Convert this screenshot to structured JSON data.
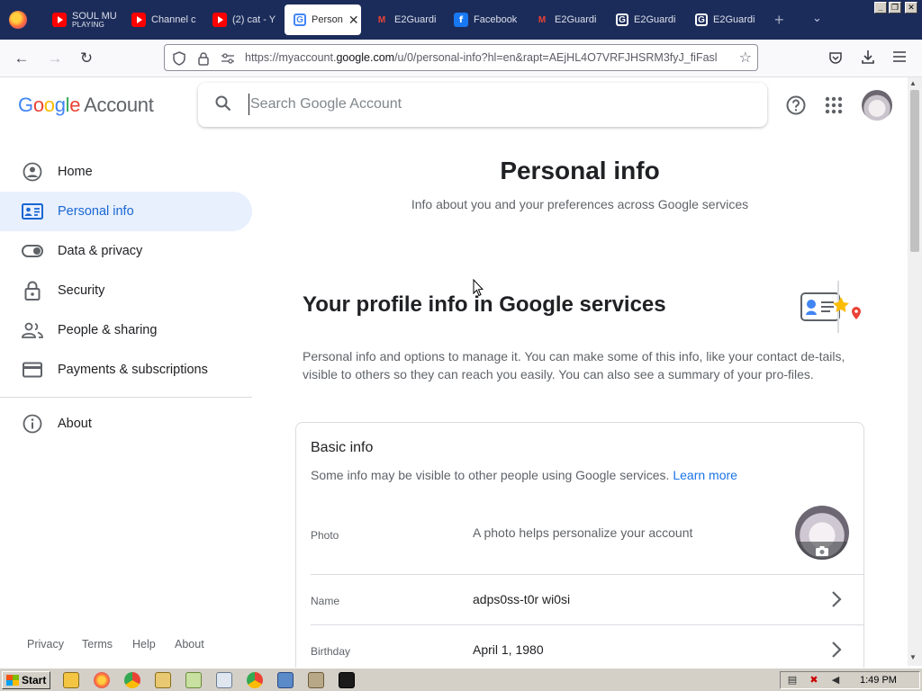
{
  "browser": {
    "tabs": [
      {
        "label": "SOUL MU",
        "sublabel": "PLAYING",
        "icon": "youtube-icon"
      },
      {
        "label": "Channel c",
        "icon": "youtube-icon"
      },
      {
        "label": "(2) cat - Y",
        "icon": "youtube-icon"
      },
      {
        "label": "Person",
        "icon": "google-icon",
        "active": true
      },
      {
        "label": "E2Guardi",
        "icon": "gmail-icon"
      },
      {
        "label": "Facebook",
        "icon": "facebook-icon"
      },
      {
        "label": "E2Guardi",
        "icon": "gmail-icon"
      },
      {
        "label": "E2Guardi",
        "icon": "google-icon"
      },
      {
        "label": "E2Guardi",
        "icon": "google-icon"
      }
    ],
    "url": {
      "prefix": "https://myaccount.",
      "domain": "google.com",
      "path": "/u/0/personal-info?hl=en&rapt=AEjHL4O7VRFJHSRM3fyJ_fiFasl"
    }
  },
  "header": {
    "logo_word": [
      "G",
      "o",
      "o",
      "g",
      "l",
      "e"
    ],
    "logo_suffix": "Account",
    "search_placeholder": "Search Google Account"
  },
  "sidebar": {
    "items": [
      {
        "label": "Home",
        "icon": "account-circle-icon"
      },
      {
        "label": "Personal info",
        "icon": "id-card-icon",
        "active": true
      },
      {
        "label": "Data & privacy",
        "icon": "toggle-icon"
      },
      {
        "label": "Security",
        "icon": "lock-icon"
      },
      {
        "label": "People & sharing",
        "icon": "people-icon"
      },
      {
        "label": "Payments & subscriptions",
        "icon": "credit-card-icon"
      }
    ],
    "about": {
      "label": "About",
      "icon": "info-icon"
    },
    "footer": [
      "Privacy",
      "Terms",
      "Help",
      "About"
    ]
  },
  "main": {
    "title": "Personal info",
    "subtitle": "Info about you and your preferences across Google services",
    "section_title": "Your profile info in Google services",
    "section_desc": "Personal info and options to manage it. You can make some of this info, like your contact de-tails, visible to others so they can reach you easily. You can also see a summary of your pro-files.",
    "card": {
      "title": "Basic info",
      "desc": "Some info may be visible to other people using Google services.",
      "learn_more": "Learn more",
      "rows": [
        {
          "label": "Photo",
          "value": "A photo helps personalize your account"
        },
        {
          "label": "Name",
          "value": "adps0ss-t0r wi0si"
        },
        {
          "label": "Birthday",
          "value": "April 1, 1980"
        }
      ]
    }
  },
  "taskbar": {
    "start_label": "Start",
    "clock": "1:49 PM"
  },
  "colors": {
    "accent": "#1a73e8",
    "active_nav_bg": "#e8f0fe",
    "active_nav_text": "#1967d2",
    "tabstrip_bg": "#1c2c5a"
  }
}
